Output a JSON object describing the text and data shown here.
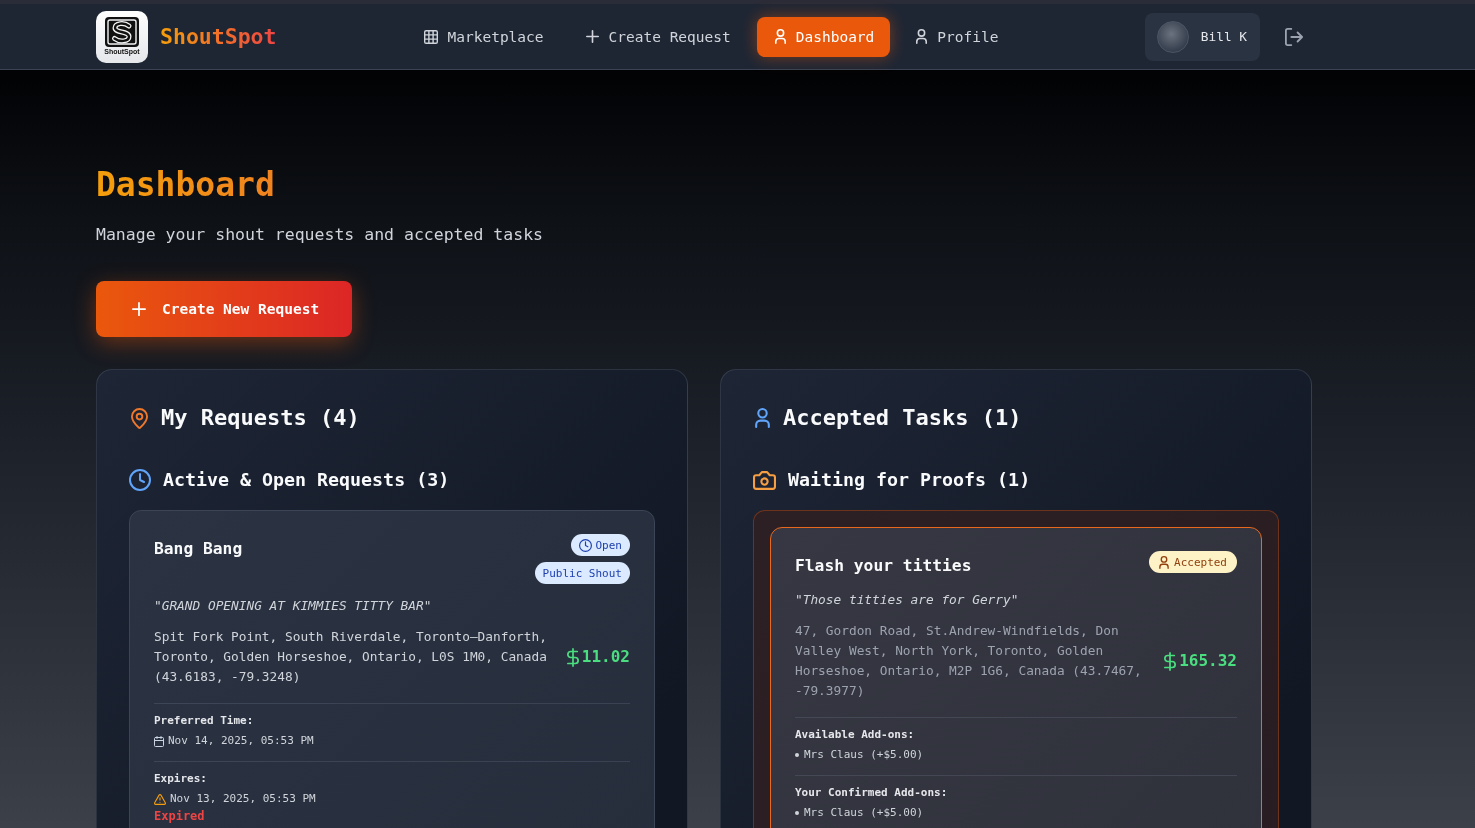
{
  "nav": {
    "logo_caption": "ShoutSpot",
    "brand": "ShoutSpot",
    "links": [
      {
        "label": "Marketplace",
        "selected": false
      },
      {
        "label": "Create Request",
        "selected": false
      },
      {
        "label": "Dashboard",
        "selected": true
      },
      {
        "label": "Profile",
        "selected": false
      }
    ],
    "user_name": "Bill K"
  },
  "header": {
    "title": "Dashboard",
    "subtitle": "Manage your shout requests and accepted tasks",
    "create_button": "Create New Request"
  },
  "panels": [
    {
      "kind": "requests",
      "title": "My Requests (4)",
      "sections": [
        {
          "kind": "active",
          "title": "Active & Open Requests (3)",
          "cards": [
            {
              "title": "Bang Bang",
              "badges": [
                {
                  "kind": "open",
                  "label": "Open"
                },
                {
                  "kind": "tag",
                  "label": "Public Shout"
                }
              ],
              "message": "\"GRAND OPENING AT KIMMIES TITTY BAR\"",
              "address": "Spit Fork Point, South Riverdale, Toronto–Danforth, Toronto, Golden Horseshoe, Ontario, L0S 1M0, Canada (43.6183, -79.3248)",
              "price": "11.02",
              "details": [
                {
                  "kind": "date",
                  "label": "Preferred Time:",
                  "value": "Nov 14, 2025, 05:53 PM"
                },
                {
                  "kind": "warning",
                  "label": "Expires:",
                  "value": "Nov 13, 2025, 05:53 PM"
                }
              ],
              "note": "Expired"
            }
          ]
        }
      ]
    },
    {
      "kind": "tasks",
      "title": "Accepted Tasks (1)",
      "sections": [
        {
          "kind": "proofs",
          "title": "Waiting for Proofs (1)",
          "cards": [
            {
              "title": "Flash your titties",
              "badges": [
                {
                  "kind": "accepted",
                  "label": "Accepted"
                }
              ],
              "message": "\"Those titties are for Gerry\"",
              "address": "47, Gordon Road, St.Andrew-Windfields, Don Valley West, North York, Toronto, Golden Horseshoe, Ontario, M2P 1G6, Canada (43.7467, -79.3977)",
              "price": "165.32",
              "details": [
                {
                  "kind": "list",
                  "label": "Available Add-ons:",
                  "items": [
                    "Mrs Claus (+$5.00)"
                  ]
                },
                {
                  "kind": "list",
                  "label": "Your Confirmed Add-ons:",
                  "items": [
                    "Mrs Claus (+$5.00)"
                  ]
                }
              ]
            }
          ]
        }
      ]
    }
  ]
}
